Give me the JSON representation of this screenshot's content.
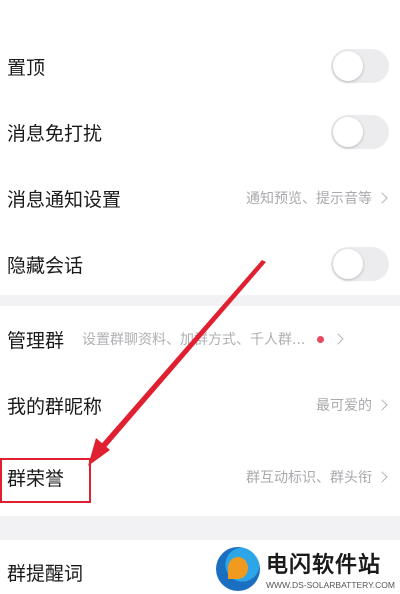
{
  "settings": {
    "pin": {
      "label": "置顶",
      "on": false
    },
    "mute": {
      "label": "消息免打扰",
      "on": false
    },
    "notify": {
      "label": "消息通知设置",
      "value": "通知预览、提示音等"
    },
    "hide": {
      "label": "隐藏会话",
      "on": false
    },
    "manage": {
      "label": "管理群",
      "value": "设置群聊资料、加群方式、千人群..."
    },
    "nickname": {
      "label": "我的群昵称",
      "value": "最可爱的"
    },
    "honor": {
      "label": "群荣誉",
      "value": "群互动标识、群头衔"
    },
    "reminder": {
      "label": "群提醒词"
    }
  },
  "watermark": {
    "name": "电闪软件站",
    "url": "WWW.DS-SOLARBATTERY.COM"
  },
  "colors": {
    "annotation_red": "#e02030",
    "badge_dot": "#e84a60",
    "toggle_off": "#ececef"
  }
}
